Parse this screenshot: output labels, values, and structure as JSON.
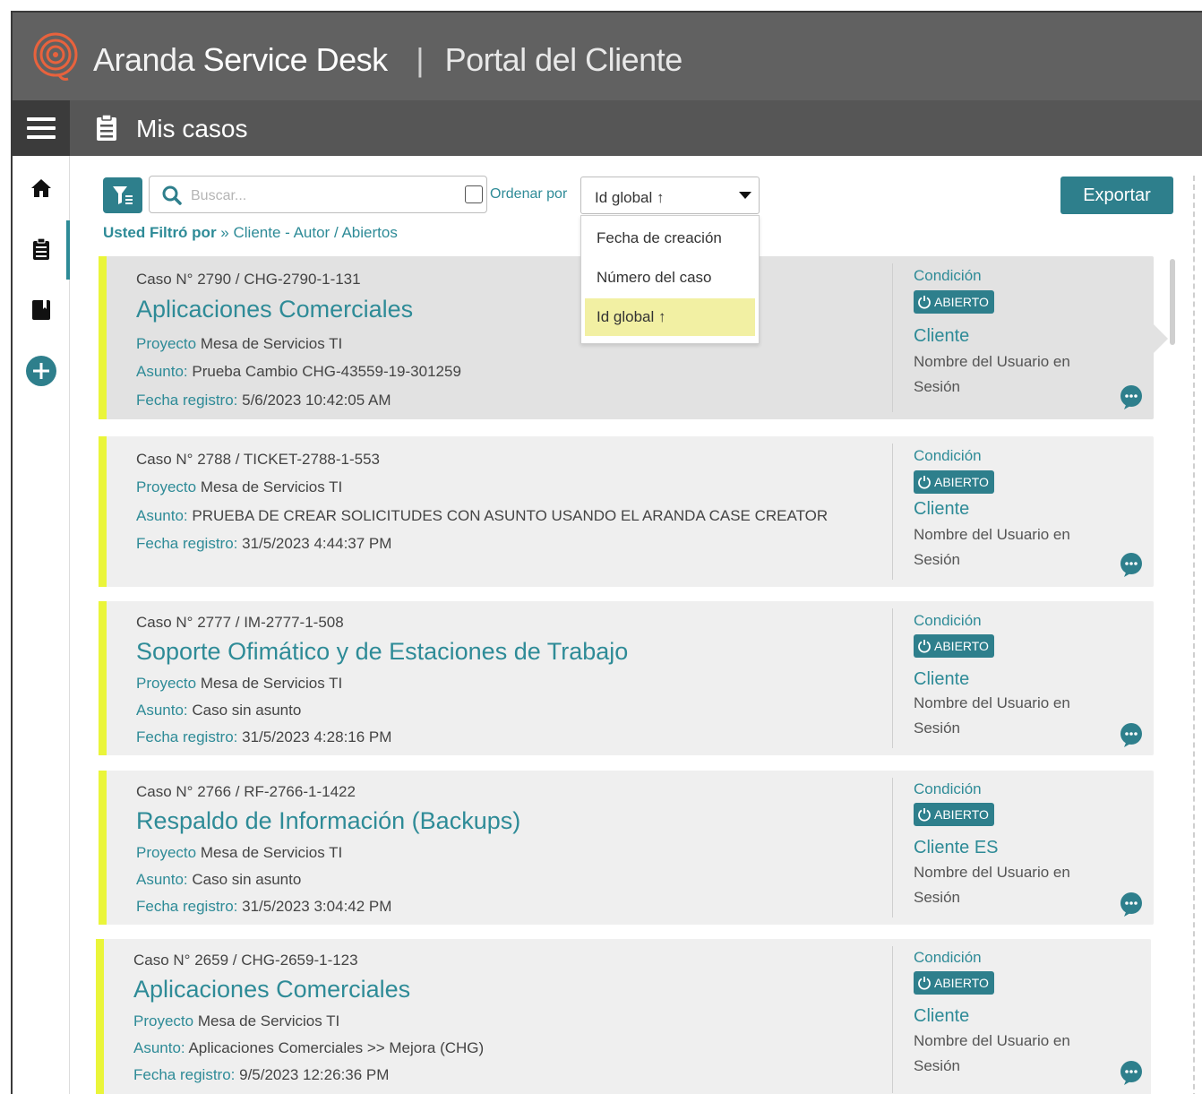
{
  "header": {
    "brand_light": "Aranda",
    "brand_bold": "Service Desk",
    "separator": "|",
    "portal": "Portal del Cliente"
  },
  "subheader": {
    "title": "Mis casos"
  },
  "toolbar": {
    "search_placeholder": "Buscar...",
    "order_label": "Ordenar por",
    "order_selected": "Id global ↑",
    "order_options": [
      "Fecha de creación",
      "Número del caso",
      "Id global ↑"
    ],
    "export_label": "Exportar"
  },
  "filter": {
    "prefix": "Usted Filtró por",
    "arrow": "»",
    "value": "Cliente - Autor / Abiertos"
  },
  "colors": {
    "accent": "#2e8b97",
    "button": "#2e7f8c",
    "stripe": "#eaf53a",
    "header": "#616161",
    "dropdown_selected": "#f2f0a3"
  },
  "labels": {
    "proyecto": "Proyecto",
    "asunto": "Asunto:",
    "fecha": "Fecha registro:",
    "condicion": "Condición",
    "badge": "ABIERTO",
    "usuario": "Nombre del Usuario en Sesión"
  },
  "cases": [
    {
      "caso": "Caso N° 2790 / CHG-2790-1-131",
      "title": "Aplicaciones Comerciales",
      "proyecto": "Mesa de Servicios TI",
      "asunto": "Prueba Cambio CHG-43559-19-301259",
      "fecha": "5/6/2023 10:42:05 AM",
      "cliente": "Cliente"
    },
    {
      "caso": "Caso N° 2788 / TICKET-2788-1-553",
      "title": "",
      "proyecto": "Mesa de Servicios TI",
      "asunto": "PRUEBA DE CREAR SOLICITUDES CON ASUNTO USANDO EL ARANDA CASE CREATOR",
      "fecha": "31/5/2023 4:44:37 PM",
      "cliente": "Cliente"
    },
    {
      "caso": "Caso N° 2777 / IM-2777-1-508",
      "title": "Soporte Ofimático y de Estaciones de Trabajo",
      "proyecto": "Mesa de Servicios TI",
      "asunto": "Caso sin asunto",
      "fecha": "31/5/2023 4:28:16 PM",
      "cliente": "Cliente"
    },
    {
      "caso": "Caso N° 2766 / RF-2766-1-1422",
      "title": "Respaldo de Información (Backups)",
      "proyecto": "Mesa de Servicios TI",
      "asunto": "Caso sin asunto",
      "fecha": "31/5/2023 3:04:42 PM",
      "cliente": "Cliente ES"
    },
    {
      "caso": "Caso N° 2659 / CHG-2659-1-123",
      "title": "Aplicaciones Comerciales",
      "proyecto": "Mesa de Servicios TI",
      "asunto": "Aplicaciones Comerciales >> Mejora (CHG)",
      "fecha": "9/5/2023 12:26:36 PM",
      "cliente": "Cliente"
    }
  ]
}
